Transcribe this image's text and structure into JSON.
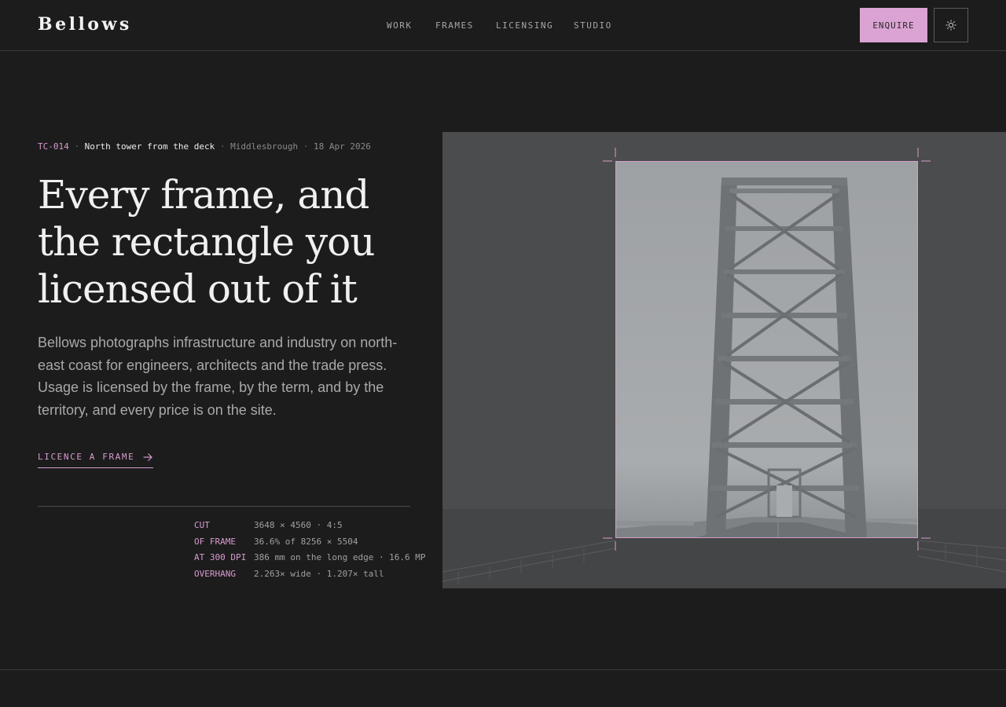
{
  "header": {
    "logo": "Bellows",
    "nav": [
      "WORK",
      "FRAMES",
      "LICENSING",
      "STUDIO"
    ],
    "enquire_label": "ENQUIRE",
    "theme_icon": "sun-icon"
  },
  "hero": {
    "meta": {
      "code": "TC-014",
      "title": "North tower from the deck",
      "place": "Middlesbrough",
      "date": "18 Apr 2026"
    },
    "headline": [
      "Every frame, and",
      "the rectangle you",
      "licensed out of it"
    ],
    "lead": "Bellows photographs infrastructure and industry on north-east coast for engineers, architects and the trade press. Usage is licensed by the frame, by the term, and by the territory, and every price is on the site.",
    "cta_label": "LICENCE A FRAME",
    "cta_icon": "arrow-right-icon"
  },
  "specs": [
    {
      "key": "CUT",
      "value": "3648 × 4560 · 4:5"
    },
    {
      "key": "OF FRAME",
      "value": "36.6% of 8256 × 5504"
    },
    {
      "key": "AT 300 DPI",
      "value": "386 mm on the long edge · 16.6 MP"
    },
    {
      "key": "OVERHANG",
      "value": "2.263× wide · 1.207× tall"
    }
  ],
  "colors": {
    "background": "#1c1c1c",
    "accent": "#dba3d3",
    "text": "#eeeeee",
    "muted": "#a9a9a9"
  }
}
